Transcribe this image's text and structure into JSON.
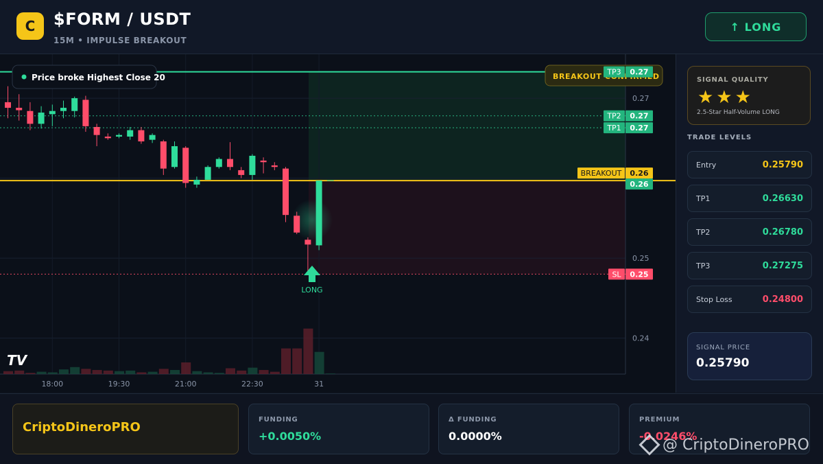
{
  "header": {
    "coin_letter": "C",
    "pair": "$FORM / USDT",
    "subtitle": "15M • IMPULSE BREAKOUT",
    "long_button": "↑ LONG"
  },
  "chart": {
    "badge": "Price broke Highest Close 20",
    "breakout_confirmed": "BREAKOUT CONFIRMED",
    "tp3_tag": "TP3",
    "long_label": "LONG",
    "tp2_tag": "TP2",
    "tp1_tag": "TP1",
    "breakout_tag": "BREAKOUT",
    "sl_tag": "SL",
    "watermark_logo": "TV"
  },
  "chart_data": {
    "type": "candlestick",
    "x_ticks": [
      "18:00",
      "19:30",
      "21:00",
      "22:30",
      "31"
    ],
    "y_ticks": [
      "0.27",
      "0.26",
      "0.25",
      "0.24"
    ],
    "price_tags": {
      "tp3": "0.27",
      "tp2": "0.27",
      "tp1": "0.27",
      "breakout": "0.26",
      "current": "0.26",
      "sl": "0.25"
    },
    "levels": {
      "tp3": 0.2733,
      "tp2": 0.2678,
      "tp1": 0.2663,
      "breakout": 0.2597,
      "sl": 0.248
    },
    "candles": [
      {
        "o": 0.2695,
        "h": 0.2715,
        "l": 0.2675,
        "c": 0.2688
      },
      {
        "o": 0.2688,
        "h": 0.2705,
        "l": 0.2672,
        "c": 0.2685
      },
      {
        "o": 0.2684,
        "h": 0.2695,
        "l": 0.266,
        "c": 0.2668
      },
      {
        "o": 0.2668,
        "h": 0.269,
        "l": 0.2662,
        "c": 0.2682
      },
      {
        "o": 0.268,
        "h": 0.2692,
        "l": 0.2665,
        "c": 0.2684
      },
      {
        "o": 0.2684,
        "h": 0.2697,
        "l": 0.2675,
        "c": 0.2688
      },
      {
        "o": 0.2684,
        "h": 0.2702,
        "l": 0.2676,
        "c": 0.27
      },
      {
        "o": 0.2698,
        "h": 0.2703,
        "l": 0.2658,
        "c": 0.2665
      },
      {
        "o": 0.2664,
        "h": 0.2668,
        "l": 0.264,
        "c": 0.2654
      },
      {
        "o": 0.2652,
        "h": 0.2656,
        "l": 0.2648,
        "c": 0.265
      },
      {
        "o": 0.2652,
        "h": 0.2656,
        "l": 0.265,
        "c": 0.2654
      },
      {
        "o": 0.2652,
        "h": 0.2664,
        "l": 0.2648,
        "c": 0.266
      },
      {
        "o": 0.266,
        "h": 0.2664,
        "l": 0.2643,
        "c": 0.2646
      },
      {
        "o": 0.2648,
        "h": 0.2656,
        "l": 0.2644,
        "c": 0.2654
      },
      {
        "o": 0.2646,
        "h": 0.2648,
        "l": 0.2604,
        "c": 0.2612
      },
      {
        "o": 0.2614,
        "h": 0.2646,
        "l": 0.2612,
        "c": 0.264
      },
      {
        "o": 0.2638,
        "h": 0.264,
        "l": 0.2588,
        "c": 0.2594
      },
      {
        "o": 0.2592,
        "h": 0.2602,
        "l": 0.2588,
        "c": 0.2598
      },
      {
        "o": 0.2598,
        "h": 0.2616,
        "l": 0.2598,
        "c": 0.2614
      },
      {
        "o": 0.2614,
        "h": 0.2626,
        "l": 0.2612,
        "c": 0.2624
      },
      {
        "o": 0.2624,
        "h": 0.2645,
        "l": 0.261,
        "c": 0.2614
      },
      {
        "o": 0.261,
        "h": 0.2614,
        "l": 0.26,
        "c": 0.2604
      },
      {
        "o": 0.2604,
        "h": 0.263,
        "l": 0.2598,
        "c": 0.2628
      },
      {
        "o": 0.2622,
        "h": 0.2626,
        "l": 0.2606,
        "c": 0.262
      },
      {
        "o": 0.2616,
        "h": 0.262,
        "l": 0.261,
        "c": 0.2614
      },
      {
        "o": 0.2612,
        "h": 0.2614,
        "l": 0.2545,
        "c": 0.2554
      },
      {
        "o": 0.2553,
        "h": 0.2558,
        "l": 0.253,
        "c": 0.2532
      },
      {
        "o": 0.2523,
        "h": 0.2526,
        "l": 0.248,
        "c": 0.2517
      },
      {
        "o": 0.2516,
        "h": 0.2597,
        "l": 0.251,
        "c": 0.2597
      },
      {
        "o": 0.2597,
        "h": 0.2597,
        "l": 0.2597,
        "c": 0.2597
      }
    ],
    "volumes": [
      0.05,
      0.06,
      0.02,
      0.04,
      0.03,
      0.08,
      0.12,
      0.09,
      0.07,
      0.06,
      0.05,
      0.06,
      0.03,
      0.04,
      0.09,
      0.07,
      0.2,
      0.05,
      0.03,
      0.02,
      0.1,
      0.06,
      0.11,
      0.07,
      0.04,
      0.44,
      0.44,
      0.78,
      0.38,
      0.01
    ],
    "ylim": [
      0.2355,
      0.2755
    ]
  },
  "sidebar": {
    "quality_title": "SIGNAL QUALITY",
    "stars": "★★★",
    "quality_desc": "2.5-Star Half-Volume LONG",
    "levels_title": "TRADE LEVELS",
    "levels": [
      {
        "label": "Entry",
        "value": "0.25790",
        "color": "#f5c518"
      },
      {
        "label": "TP1",
        "value": "0.26630",
        "color": "#2fdc9b"
      },
      {
        "label": "TP2",
        "value": "0.26780",
        "color": "#2fdc9b"
      },
      {
        "label": "TP3",
        "value": "0.27275",
        "color": "#2fdc9b"
      },
      {
        "label": "Stop Loss",
        "value": "0.24800",
        "color": "#ff4d6a"
      }
    ],
    "signal_price_label": "SIGNAL PRICE",
    "signal_price": "0.25790"
  },
  "footer": {
    "brand": "CriptoDineroPRO",
    "boxes": [
      {
        "label": "FUNDING",
        "value": "+0.0050%",
        "color": "#2fdc9b"
      },
      {
        "label": "Δ FUNDING",
        "value": "0.0000%",
        "color": "#ffffff"
      },
      {
        "label": "PREMIUM",
        "value": "-0.0246%",
        "color": "#ff4d6a"
      }
    ],
    "watermark": "@ CriptoDineroPRO"
  }
}
